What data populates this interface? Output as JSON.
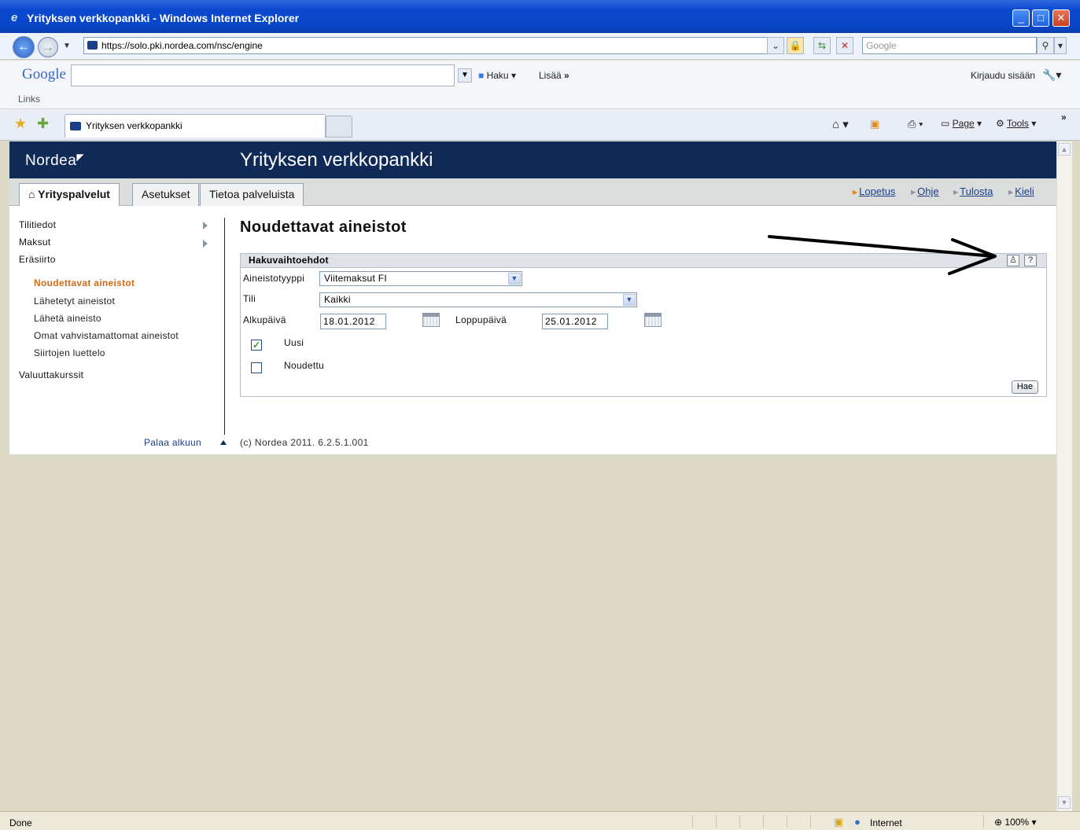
{
  "window": {
    "title": "Yrityksen verkkopankki - Windows Internet Explorer"
  },
  "address": {
    "url": "https://solo.pki.nordea.com/nsc/engine",
    "search_placeholder": "Google"
  },
  "google_bar": {
    "logo": "Google",
    "search_label": "Haku",
    "more_label": "Lisää",
    "signin_label": "Kirjaudu sisään",
    "links_label": "Links"
  },
  "browser_tab": {
    "title": "Yrityksen verkkopankki"
  },
  "ie_toolbar": {
    "page_label": "Page",
    "tools_label": "Tools"
  },
  "header": {
    "logo": "Nordea",
    "title": "Yrityksen verkkopankki"
  },
  "main_tabs": [
    {
      "label": "Yrityspalvelut"
    },
    {
      "label": "Asetukset"
    },
    {
      "label": "Tietoa palveluista"
    }
  ],
  "top_links": [
    {
      "label": "Lopetus"
    },
    {
      "label": "Ohje"
    },
    {
      "label": "Tulosta"
    },
    {
      "label": "Kieli"
    }
  ],
  "sidebar": {
    "items": [
      {
        "label": "Tilitiedot"
      },
      {
        "label": "Maksut"
      },
      {
        "label": "Eräsiirto"
      },
      {
        "label": "Noudettavat aineistot"
      },
      {
        "label": "Lähetetyt aineistot"
      },
      {
        "label": "Lähetä aineisto"
      },
      {
        "label": "Omat vahvistamattomat aineistot"
      },
      {
        "label": "Siirtojen luettelo"
      },
      {
        "label": "Valuuttakurssit"
      }
    ],
    "back_to_top": "Palaa alkuun"
  },
  "main": {
    "page_title": "Noudettavat aineistot",
    "panel_title": "Hakuvaihtoehdot",
    "form": {
      "type_label": "Aineistotyyppi",
      "type_value": "Viitemaksut FI",
      "account_label": "Tili",
      "account_value": "Kaikki",
      "start_label": "Alkupäivä",
      "start_value": "18.01.2012",
      "end_label": "Loppupäivä",
      "end_value": "25.01.2012",
      "new_label": "Uusi",
      "new_checked": true,
      "fetched_label": "Noudettu",
      "fetched_checked": false,
      "search_button": "Hae",
      "help_icon": "?"
    },
    "footer": "(c) Nordea 2011. 6.2.5.1.001"
  },
  "status": {
    "left": "Done",
    "zone": "Internet",
    "zoom": "100%"
  }
}
